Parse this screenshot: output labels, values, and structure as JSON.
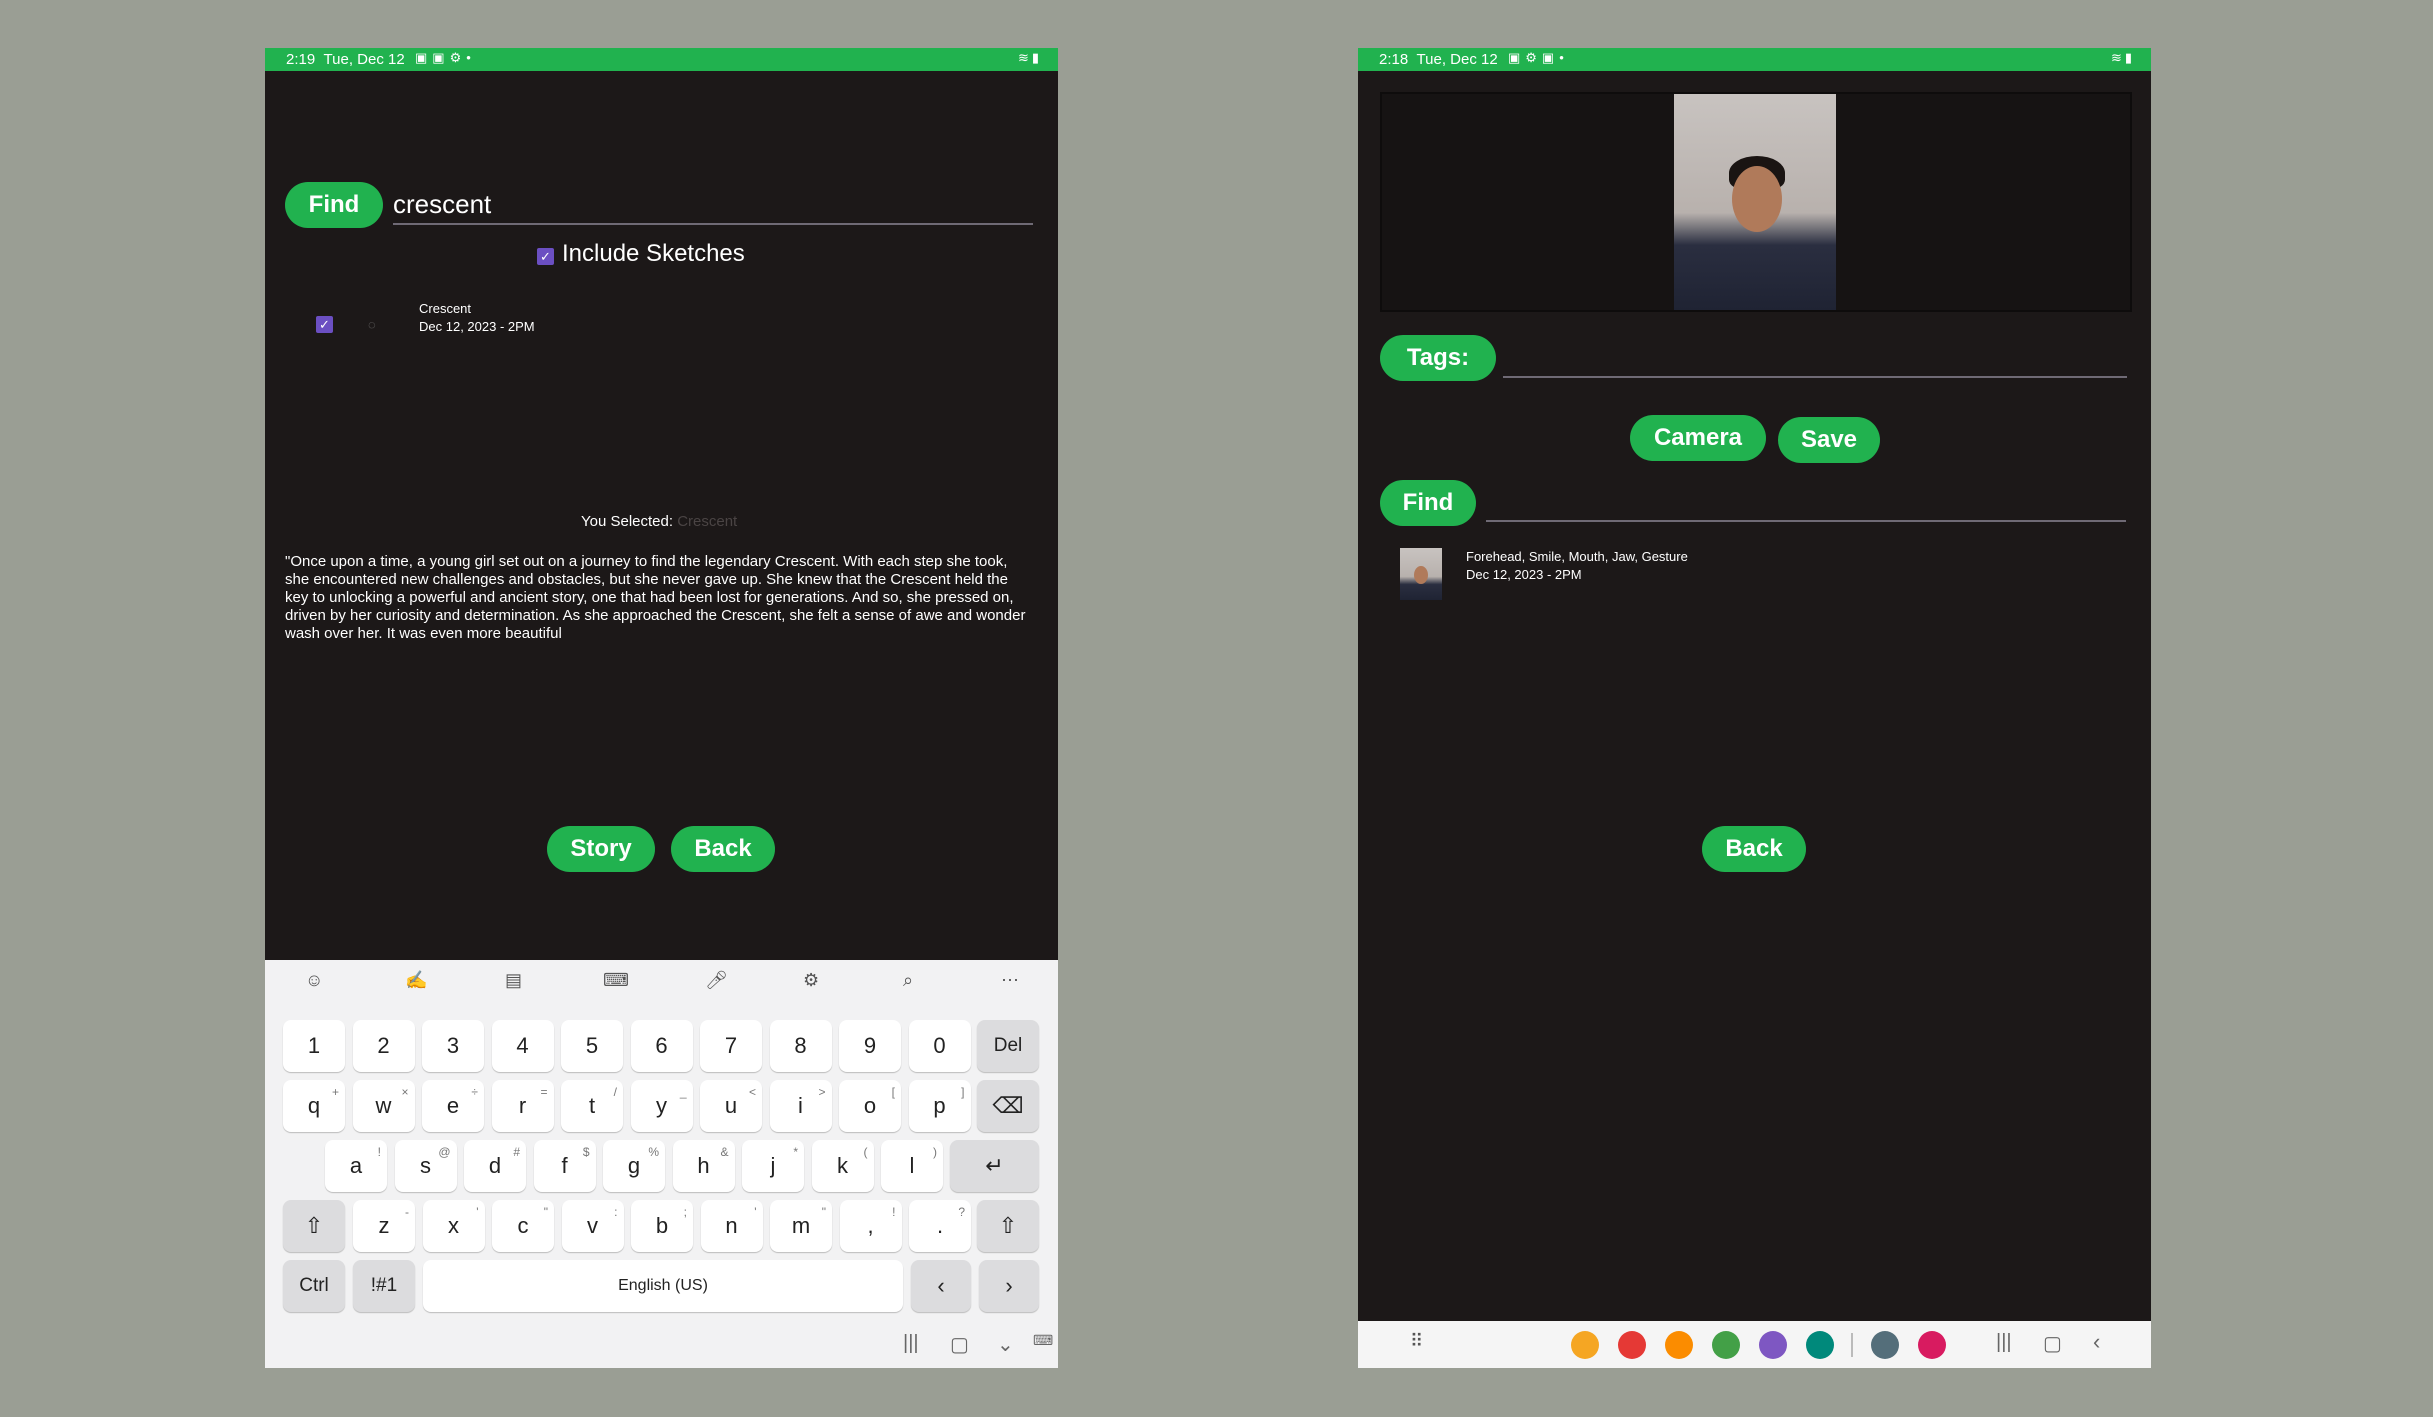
{
  "left": {
    "status": {
      "time": "2:19",
      "date": "Tue, Dec 12"
    },
    "find_button": "Find",
    "search_value": "crescent",
    "include_sketches_label": "Include Sketches",
    "result": {
      "title": "Crescent",
      "date": "Dec 12, 2023 - 2PM"
    },
    "you_selected_label": "You Selected:",
    "you_selected_value": "Crescent",
    "story_text": "\"Once upon a time, a young girl set out on a journey to find the legendary Crescent. With each step she took, she encountered new challenges and obstacles, but she never gave up. She knew that the Crescent held the key to unlocking a powerful and ancient story, one that had been lost for generations. And so, she pressed on, driven by her curiosity and determination. As she approached the Crescent, she felt a sense of awe and wonder wash over her. It was even more beautiful",
    "story_button": "Story",
    "back_button": "Back",
    "keyboard": {
      "toolbar_icons": [
        "emoji-icon",
        "handwriting-icon",
        "clipboard-icon",
        "keyboard-layout-icon",
        "microphone-icon",
        "settings-icon",
        "search-icon",
        "more-icon"
      ],
      "row_numbers": [
        "1",
        "2",
        "3",
        "4",
        "5",
        "6",
        "7",
        "8",
        "9",
        "0"
      ],
      "del": "Del",
      "row_q": [
        "q",
        "w",
        "e",
        "r",
        "t",
        "y",
        "u",
        "i",
        "o",
        "p"
      ],
      "row_q_sup": [
        "+",
        "×",
        "÷",
        "=",
        "/",
        "_",
        "<",
        ">",
        "[",
        "]"
      ],
      "row_a": [
        "a",
        "s",
        "d",
        "f",
        "g",
        "h",
        "j",
        "k",
        "l"
      ],
      "row_a_sup": [
        "!",
        "@",
        "#",
        "$",
        "%",
        "&",
        "*",
        "(",
        ")"
      ],
      "row_z": [
        "z",
        "x",
        "c",
        "v",
        "b",
        "n",
        "m",
        ",",
        "."
      ],
      "row_z_sup": [
        "-",
        "'",
        "\"",
        ":",
        ";",
        "'",
        "\"",
        "!",
        "?"
      ],
      "ctrl": "Ctrl",
      "sym": "!#1",
      "space": "English (US)"
    }
  },
  "right": {
    "status": {
      "time": "2:18",
      "date": "Tue, Dec 12"
    },
    "tags_button": "Tags:",
    "tags_value": "",
    "camera_button": "Camera",
    "save_button": "Save",
    "find_button": "Find",
    "find_value": "",
    "result": {
      "title": "Forehead, Smile, Mouth, Jaw, Gesture",
      "date": "Dec 12, 2023 - 2PM"
    },
    "back_button": "Back",
    "dock_apps": [
      {
        "name": "files-app-icon",
        "color": "#f5a623"
      },
      {
        "name": "notes-app-icon",
        "color": "#e53935"
      },
      {
        "name": "contacts-app-icon",
        "color": "#fb8c00"
      },
      {
        "name": "calculator-app-icon",
        "color": "#43a047"
      },
      {
        "name": "internet-app-icon",
        "color": "#7e57c2"
      },
      {
        "name": "calendar-app-icon",
        "color": "#00897b"
      },
      {
        "name": "settings-app-icon",
        "color": "#546e7a"
      },
      {
        "name": "bixby-app-icon",
        "color": "#d81b60"
      }
    ]
  },
  "colors": {
    "accent": "#21b24f",
    "background": "#1c1818",
    "check": "#6b4fc2"
  }
}
